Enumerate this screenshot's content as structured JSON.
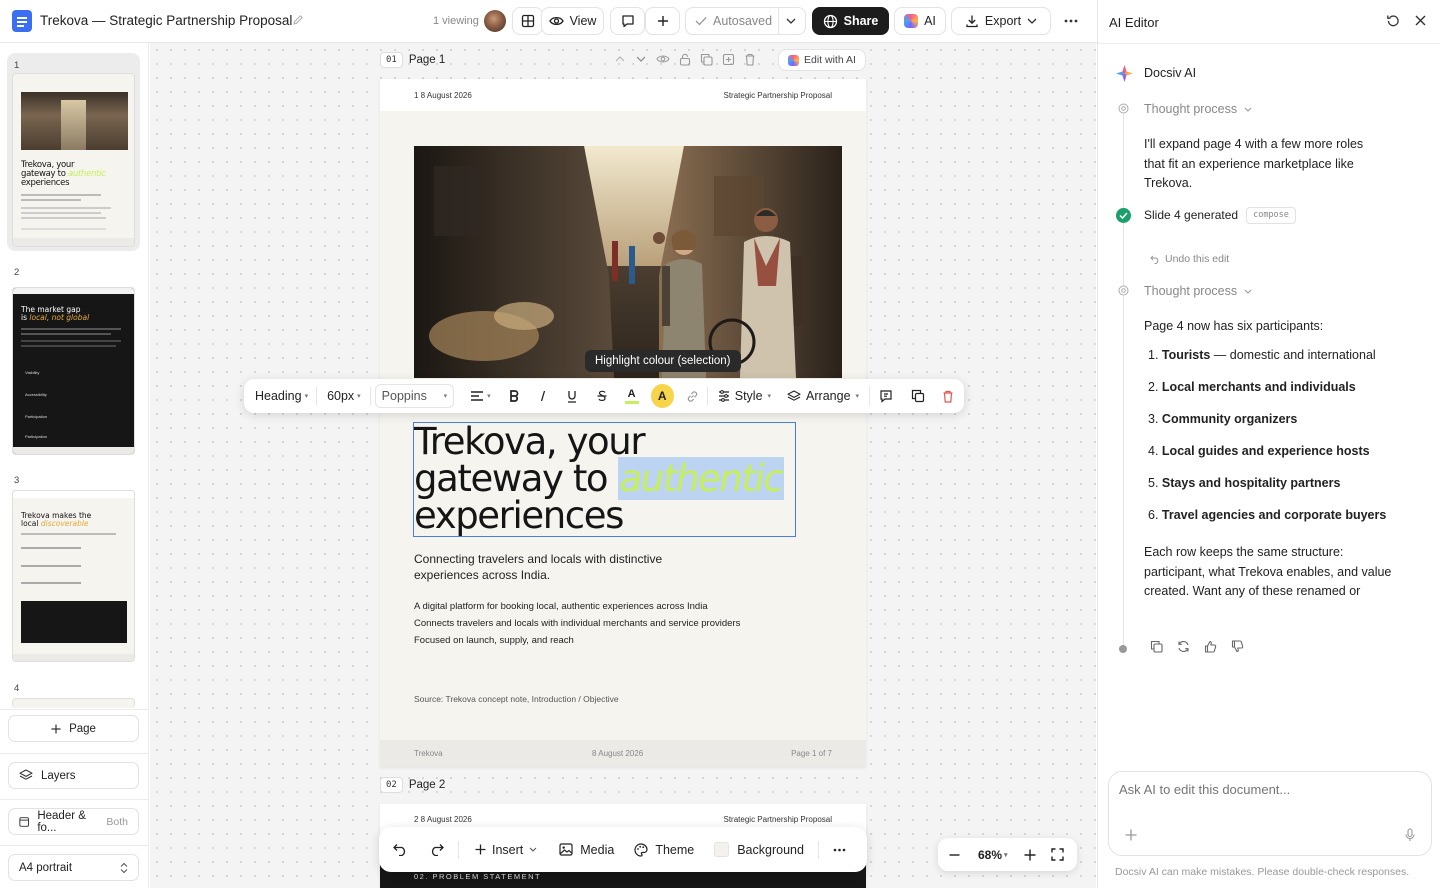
{
  "topbar": {
    "doc_title": "Trekova — Strategic Partnership Proposal",
    "viewing": "1 viewing",
    "view_label": "View",
    "autosaved_label": "Autosaved",
    "share_label": "Share",
    "ai_label": "AI",
    "export_label": "Export"
  },
  "sidebar": {
    "pages": [
      {
        "number": "1",
        "date": "1 8 August 2026",
        "title_a": "Trekova, your",
        "title_b": "gateway to",
        "title_accent": "authentic",
        "title_c": "experiences"
      },
      {
        "number": "2",
        "title_a": "The market gap",
        "title_b": "is",
        "title_accent": "local, not global",
        "items": [
          "Visibility",
          "Accessibility",
          "Participation",
          "Participation"
        ]
      },
      {
        "number": "3",
        "title_a": "Trekova makes the",
        "title_b": "local",
        "title_accent": "discoverable"
      },
      {
        "number": "4"
      }
    ],
    "add_page_label": "Page",
    "layers_label": "Layers",
    "header_footer_label": "Header & fo...",
    "header_footer_value": "Both",
    "page_size_label": "A4 portrait"
  },
  "canvas": {
    "page1": {
      "num": "01",
      "label": "Page 1",
      "edit_ai_label": "Edit with AI",
      "header_date": "1 8 August 2026",
      "header_right": "Strategic Partnership Proposal",
      "hero_line1": "Trekova, your",
      "hero_line2_prefix": "gateway to",
      "hero_accent": "authentic",
      "hero_line3": "experiences",
      "subtitle": "Connecting travelers and locals with distinctive experiences across India.",
      "bullets": [
        "A digital platform for booking local, authentic experiences across India",
        "Connects travelers and locals with individual merchants and service providers",
        "Focused on launch, supply, and reach"
      ],
      "source": "Source: Trekova concept note, Introduction / Objective",
      "footer_left": "Trekova",
      "footer_center": "8 August 2026",
      "footer_right": "Page 1 of 7"
    },
    "page2": {
      "num": "02",
      "label": "Page 2",
      "header_date": "2 8 August 2026",
      "header_right": "Strategic Partnership Proposal",
      "section_label": "02. PROBLEM STATEMENT"
    },
    "tooltip": "Highlight colour (selection)",
    "format_toolbar": {
      "block_type": "Heading",
      "font_size": "60px",
      "font_family": "Poppins",
      "style_label": "Style",
      "arrange_label": "Arrange",
      "text_color": "#c7ef5a",
      "highlight_color": "#f7d54a"
    },
    "bottom_toolbar": {
      "insert_label": "Insert",
      "media_label": "Media",
      "theme_label": "Theme",
      "background_label": "Background"
    },
    "zoom": {
      "value": "68%"
    }
  },
  "ai_panel": {
    "title": "AI Editor",
    "assistant_name": "Docsiv AI",
    "thought_label": "Thought process",
    "message1": "I'll expand page 4 with a few more roles that fit an experience marketplace like Trekova.",
    "generated_label": "Slide 4 generated",
    "generated_tag": "compose",
    "undo_label": "Undo this edit",
    "thought_label_2": "Thought process",
    "intro": "Page 4 now has six participants:",
    "participants": [
      {
        "num": "1.",
        "bold": "Tourists",
        "rest": " — domestic and international"
      },
      {
        "num": "2.",
        "bold": "Local merchants and individuals",
        "rest": ""
      },
      {
        "num": "3.",
        "bold": "Community organizers",
        "rest": ""
      },
      {
        "num": "4.",
        "bold": "Local guides and experience hosts",
        "rest": ""
      },
      {
        "num": "5.",
        "bold": "Stays and hospitality partners",
        "rest": ""
      },
      {
        "num": "6.",
        "bold": "Travel agencies and corporate buyers",
        "rest": ""
      }
    ],
    "closing": "Each row keeps the same structure: participant, what Trekova enables, and value created. Want any of these renamed or",
    "input_placeholder": "Ask AI to edit this document...",
    "disclaimer": "Docsiv AI can make mistakes. Please double-check responses.",
    "accent_color": "#1aa06b"
  }
}
